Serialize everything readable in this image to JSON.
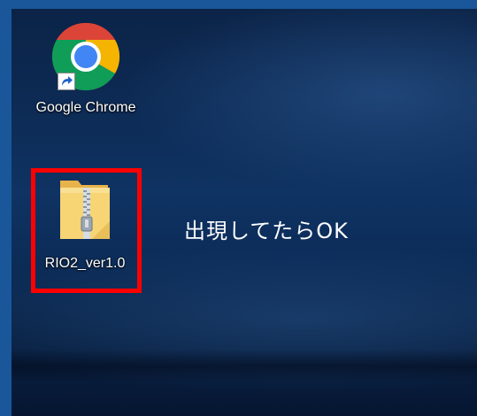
{
  "desktop": {
    "icons": [
      {
        "label": "Google Chrome",
        "icon": "chrome-icon",
        "shortcut": true
      },
      {
        "label": "RIO2_ver1.0",
        "icon": "zip-folder-icon",
        "shortcut": false
      }
    ]
  },
  "annotation": {
    "text": "出現してたらOK",
    "highlight_color": "#ff0000"
  },
  "colors": {
    "frame": "#19579a",
    "desktop_background": "#0d2c57",
    "label_text": "#ffffff"
  }
}
